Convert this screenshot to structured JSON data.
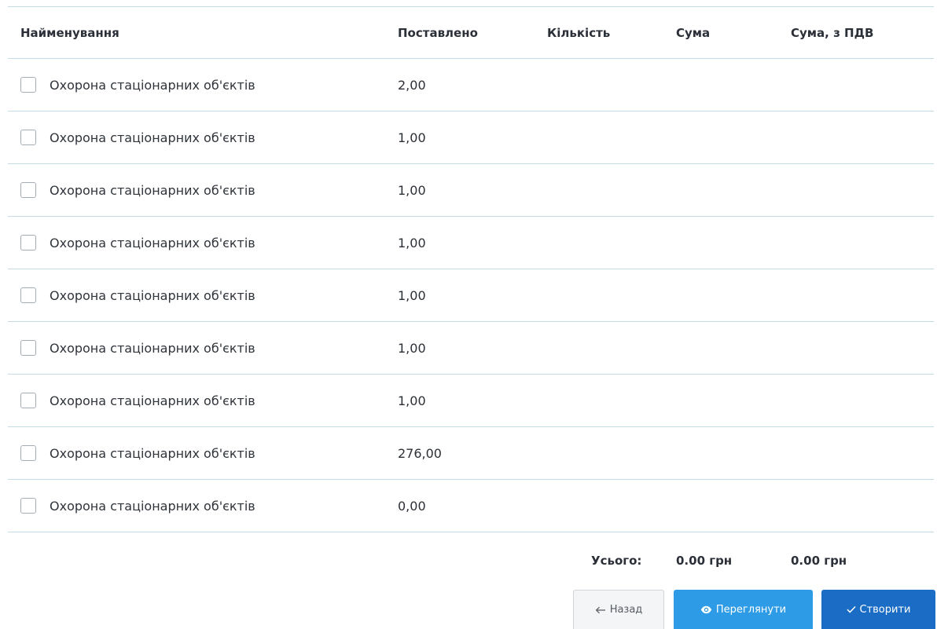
{
  "table": {
    "headers": {
      "name": "Найменування",
      "delivered": "Поставлено",
      "quantity": "Кількість",
      "sum": "Сума",
      "sum_vat": "Сума, з ПДВ"
    },
    "rows": [
      {
        "name": "Охорона стаціонарних об'єктів",
        "delivered": "2,00",
        "checked": false
      },
      {
        "name": "Охорона стаціонарних об'єктів",
        "delivered": "1,00",
        "checked": false
      },
      {
        "name": "Охорона стаціонарних об'єктів",
        "delivered": "1,00",
        "checked": false
      },
      {
        "name": "Охорона стаціонарних об'єктів",
        "delivered": "1,00",
        "checked": false
      },
      {
        "name": "Охорона стаціонарних об'єктів",
        "delivered": "1,00",
        "checked": false
      },
      {
        "name": "Охорона стаціонарних об'єктів",
        "delivered": "1,00",
        "checked": false
      },
      {
        "name": "Охорона стаціонарних об'єктів",
        "delivered": "1,00",
        "checked": false
      },
      {
        "name": "Охорона стаціонарних об'єктів",
        "delivered": "276,00",
        "checked": false
      },
      {
        "name": "Охорона стаціонарних об'єктів",
        "delivered": "0,00",
        "checked": false
      }
    ]
  },
  "totals": {
    "label": "Усього:",
    "sum": "0.00 грн",
    "sum_vat": "0.00 грн"
  },
  "actions": {
    "back": {
      "label": "Назад",
      "icon": "arrow-left-icon"
    },
    "preview": {
      "label": "Переглянути",
      "icon": "eye-icon"
    },
    "create": {
      "label": "Створити",
      "icon": "checkmark-icon"
    }
  },
  "colors": {
    "row_border": "#c5dbe4",
    "preview_button": "#2e9be6",
    "create_button": "#1a6cc4",
    "back_button": "#f4f5f6"
  }
}
